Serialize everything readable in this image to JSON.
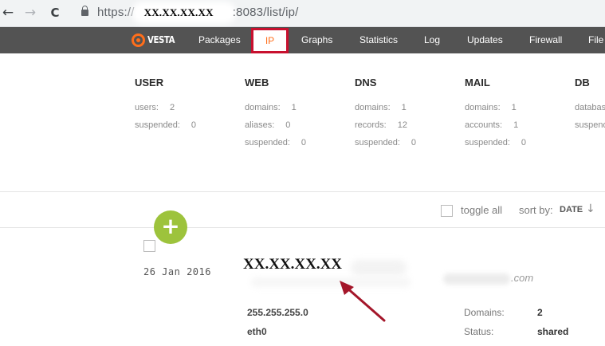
{
  "browser": {
    "back_icon": "←",
    "forward_icon": "→",
    "reload_icon": "C",
    "url_prefix": "https://",
    "url_host_redacted": "XX.XX.XX.XX",
    "url_suffix": ":8083/list/ip/"
  },
  "menu": {
    "logo_text": "VESTA",
    "items": [
      "Packages",
      "IP",
      "Graphs",
      "Statistics",
      "Log",
      "Updates",
      "Firewall",
      "File"
    ],
    "active": "IP",
    "accent_color": "#ff6e1b",
    "highlight_color": "#c8102e"
  },
  "stats": {
    "user": {
      "title": "USER",
      "rows": [
        [
          "users:",
          "2"
        ],
        [
          "suspended:",
          "0"
        ]
      ]
    },
    "web": {
      "title": "WEB",
      "rows": [
        [
          "domains:",
          "1"
        ],
        [
          "aliases:",
          "0"
        ],
        [
          "suspended:",
          "0"
        ]
      ]
    },
    "dns": {
      "title": "DNS",
      "rows": [
        [
          "domains:",
          "1"
        ],
        [
          "records:",
          "12"
        ],
        [
          "suspended:",
          "0"
        ]
      ]
    },
    "mail": {
      "title": "MAIL",
      "rows": [
        [
          "domains:",
          "1"
        ],
        [
          "accounts:",
          "1"
        ],
        [
          "suspended:",
          "0"
        ]
      ]
    },
    "db": {
      "title": "DB",
      "rows": [
        [
          "databas",
          ""
        ],
        [
          "suspend",
          ""
        ]
      ]
    }
  },
  "toolbar": {
    "toggle_all": "toggle all",
    "sort_by": "sort by:",
    "sort_value": "DATE",
    "sort_arrow": "↓",
    "add_label": "+"
  },
  "ip_row": {
    "date": "26 Jan 2016",
    "ip": "XX.XX.XX.XX",
    "domain_suffix": ".com",
    "netmask": "255.255.255.0",
    "interface": "eth0",
    "domains_label": "Domains:",
    "domains_value": "2",
    "status_label": "Status:",
    "status_value": "shared"
  }
}
